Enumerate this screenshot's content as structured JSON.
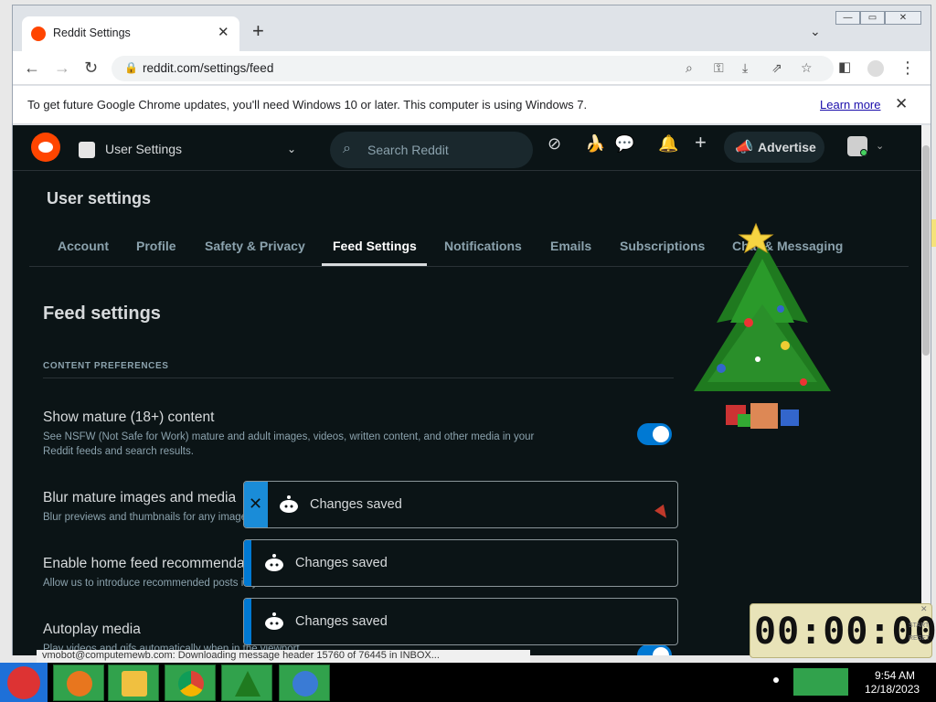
{
  "browser": {
    "tab_title": "Reddit Settings",
    "tab_close": "✕",
    "new_tab": "+",
    "tab_search": "⌄",
    "url": "reddit.com/settings/feed",
    "window_controls": {
      "minimize": "—",
      "maximize": "▭",
      "close": "✕"
    }
  },
  "infobar": {
    "message": "To get future Google Chrome updates, you'll need Windows 10 or later. This computer is using Windows 7.",
    "link": "Learn more",
    "close": "✕"
  },
  "reddit_header": {
    "community_label": "User Settings",
    "search_placeholder": "Search Reddit",
    "advertise_label": "Advertise"
  },
  "settings": {
    "title": "User settings",
    "tabs": [
      {
        "label": "Account"
      },
      {
        "label": "Profile"
      },
      {
        "label": "Safety & Privacy"
      },
      {
        "label": "Feed Settings"
      },
      {
        "label": "Notifications"
      },
      {
        "label": "Emails"
      },
      {
        "label": "Subscriptions"
      },
      {
        "label": "Chat & Messaging"
      }
    ],
    "active_tab": "Feed Settings",
    "section_title": "Feed settings",
    "group_label": "CONTENT PREFERENCES",
    "options": [
      {
        "title": "Show mature (18+) content",
        "desc": "See NSFW (Not Safe for Work) mature and adult images, videos, written content, and other media in your Reddit feeds and search results.",
        "enabled": true
      },
      {
        "title": "Blur mature images and media",
        "desc": "Blur previews and thumbnails for any images or videos marked as NSFW."
      },
      {
        "title": "Enable home feed recommendations",
        "desc": "Allow us to introduce recommended posts in your home feed."
      },
      {
        "title": "Autoplay media",
        "desc": "Play videos and gifs automatically when in the viewport."
      }
    ]
  },
  "toasts": [
    {
      "text": "Changes saved",
      "close": "✕"
    },
    {
      "text": "Changes saved"
    },
    {
      "text": "Changes saved"
    }
  ],
  "statusbar": {
    "text": "vmobot@computemewb.com: Downloading message header 15760 of 76445 in INBOX..."
  },
  "timer": {
    "digits": "00:00:00",
    "label_start": "START",
    "label_reset": "RESET",
    "close": "✕"
  },
  "taskbar": {
    "time": "9:54 AM",
    "date": "12/18/2023"
  },
  "colors": {
    "reddit_orange": "#ff4500",
    "toggle_blue": "#0079d3",
    "page_bg": "#0b1416"
  },
  "icons": [
    "back-icon",
    "forward-icon",
    "reload-icon",
    "lock-icon",
    "zoom-icon",
    "key-icon",
    "install-icon",
    "share-icon",
    "star-icon",
    "sidepanel-icon",
    "profile-icon",
    "menu-icon",
    "search-icon",
    "popular-icon",
    "banana-icon",
    "chat-icon",
    "bell-icon",
    "plus-icon",
    "megaphone-icon"
  ]
}
